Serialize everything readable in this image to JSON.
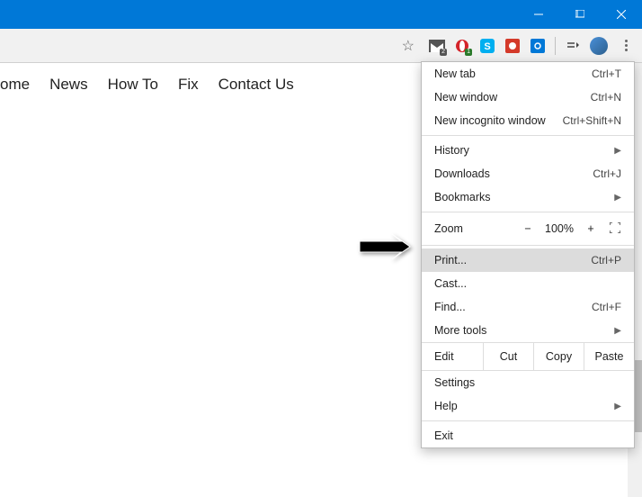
{
  "window": {
    "min": "minimize",
    "max": "maximize",
    "close": "close"
  },
  "toolbar": {
    "star": "☆",
    "gmail_badge": "2",
    "opera_badge": "1"
  },
  "nav": {
    "home": "ome",
    "news": "News",
    "howto": "How To",
    "fix": "Fix",
    "contact": "Contact Us"
  },
  "menu": {
    "new_tab": "New tab",
    "new_tab_sc": "Ctrl+T",
    "new_window": "New window",
    "new_window_sc": "Ctrl+N",
    "incognito": "New incognito window",
    "incognito_sc": "Ctrl+Shift+N",
    "history": "History",
    "downloads": "Downloads",
    "downloads_sc": "Ctrl+J",
    "bookmarks": "Bookmarks",
    "zoom": "Zoom",
    "zoom_minus": "−",
    "zoom_val": "100%",
    "zoom_plus": "+",
    "print": "Print...",
    "print_sc": "Ctrl+P",
    "cast": "Cast...",
    "find": "Find...",
    "find_sc": "Ctrl+F",
    "more_tools": "More tools",
    "edit": "Edit",
    "cut": "Cut",
    "copy": "Copy",
    "paste": "Paste",
    "settings": "Settings",
    "help": "Help",
    "exit": "Exit"
  }
}
